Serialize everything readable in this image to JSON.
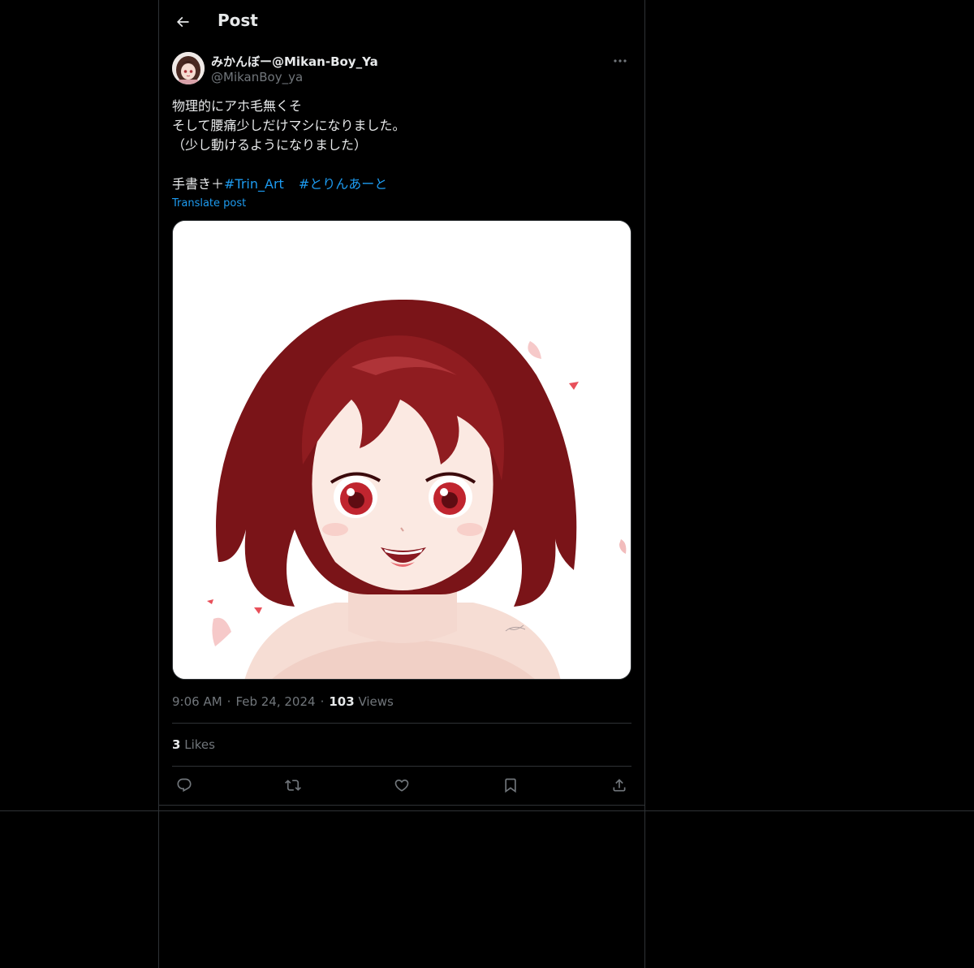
{
  "header": {
    "title": "Post"
  },
  "author": {
    "display_name": "みかんぼー@Mikan-Boy_Ya",
    "handle": "@MikanBoy_ya"
  },
  "post": {
    "lines": [
      "物理的にアホ毛無くそ",
      "そして腰痛少しだけマシになりました。",
      "（少し動けるようになりました）",
      ""
    ],
    "last_line_prefix": "手書き＋",
    "hashtags": [
      "#Trin_Art",
      "#とりんあーと"
    ],
    "translate_label": "Translate post"
  },
  "meta": {
    "time": "9:06 AM",
    "date": "Feb 24, 2024",
    "views_count": "103",
    "views_label": "Views",
    "separator": "·"
  },
  "likes": {
    "count": "3",
    "label": "Likes"
  },
  "actions": [
    "reply-icon",
    "repost-icon",
    "like-icon",
    "bookmark-icon",
    "share-icon"
  ],
  "colors": {
    "background": "#000000",
    "text": "#e7e9ea",
    "muted": "#71767b",
    "accent": "#1d9bf0",
    "border": "#2f3336"
  }
}
